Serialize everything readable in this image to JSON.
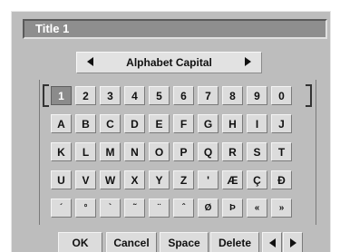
{
  "title_field": {
    "value": "Title 1"
  },
  "mode": {
    "label": "Alphabet Capital"
  },
  "keyboard": {
    "selected": "1",
    "rows": [
      [
        "1",
        "2",
        "3",
        "4",
        "5",
        "6",
        "7",
        "8",
        "9",
        "0"
      ],
      [
        "A",
        "B",
        "C",
        "D",
        "E",
        "F",
        "G",
        "H",
        "I",
        "J"
      ],
      [
        "K",
        "L",
        "M",
        "N",
        "O",
        "P",
        "Q",
        "R",
        "S",
        "T"
      ],
      [
        "U",
        "V",
        "W",
        "X",
        "Y",
        "Z",
        "'",
        "Æ",
        "Ç",
        "Đ"
      ],
      [
        "´",
        "°",
        "`",
        "˜",
        "¨",
        "ˆ",
        "Ø",
        "Þ",
        "«",
        "»"
      ]
    ]
  },
  "buttons": {
    "ok": "OK",
    "cancel": "Cancel",
    "space": "Space",
    "delete": "Delete"
  },
  "icons": {
    "mode_prev": "triangle-left-icon",
    "mode_next": "triangle-right-icon",
    "cursor_left": "triangle-left-icon",
    "cursor_right": "triangle-right-icon"
  },
  "colors": {
    "panel": "#bdbdbd",
    "title_field": "#8e8e8e",
    "key": "#dcdcdc",
    "selected_key": "#8b8b8b"
  }
}
